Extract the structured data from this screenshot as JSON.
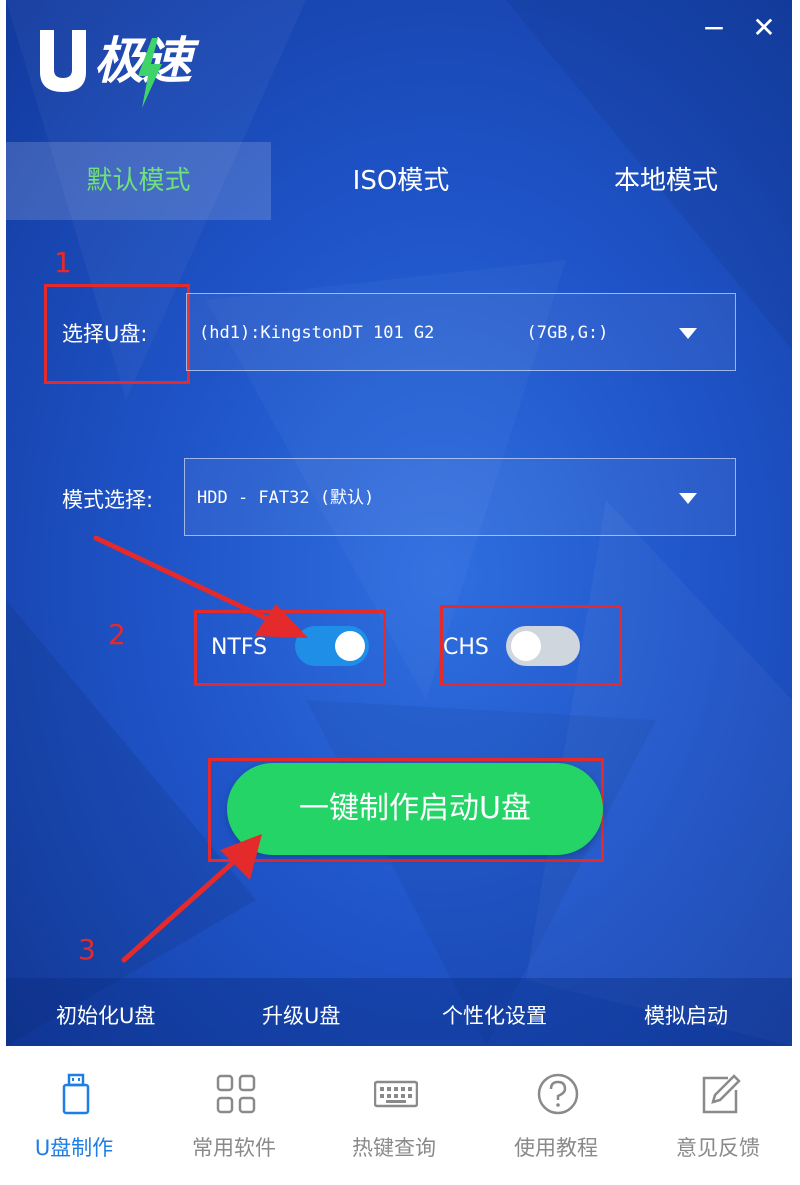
{
  "app": {
    "logo_text": "极速",
    "logo_letter": "U",
    "minimize_glyph": "−",
    "close_glyph": "✕",
    "colors": {
      "accent_green": "#25d467",
      "active_tab_text": "#6fe07a",
      "toggle_on": "#1e8ee6",
      "annotation_red": "#e42a2a",
      "nav_active": "#1e7ee6"
    }
  },
  "tabs": [
    {
      "label": "默认模式",
      "active": true
    },
    {
      "label": "ISO模式",
      "active": false
    },
    {
      "label": "本地模式",
      "active": false
    }
  ],
  "usb_select": {
    "label": "选择U盘:",
    "value": "(hd1):KingstonDT 101 G2         (7GB,G:)"
  },
  "mode_select": {
    "label": "模式选择:",
    "value": "HDD - FAT32 (默认)"
  },
  "toggles": {
    "ntfs": {
      "label": "NTFS",
      "on": true
    },
    "chs": {
      "label": "CHS",
      "on": false
    }
  },
  "start_button": {
    "label": "一键制作启动U盘"
  },
  "annotations": [
    "1",
    "2",
    "3"
  ],
  "bottom_links": [
    {
      "label": "初始化U盘"
    },
    {
      "label": "升级U盘"
    },
    {
      "label": "个性化设置"
    },
    {
      "label": "模拟启动"
    }
  ],
  "nav": [
    {
      "label": "U盘制作",
      "icon": "usb-drive-icon",
      "active": true
    },
    {
      "label": "常用软件",
      "icon": "apps-grid-icon",
      "active": false
    },
    {
      "label": "热键查询",
      "icon": "keyboard-icon",
      "active": false
    },
    {
      "label": "使用教程",
      "icon": "help-circle-icon",
      "active": false
    },
    {
      "label": "意见反馈",
      "icon": "edit-feedback-icon",
      "active": false
    }
  ]
}
